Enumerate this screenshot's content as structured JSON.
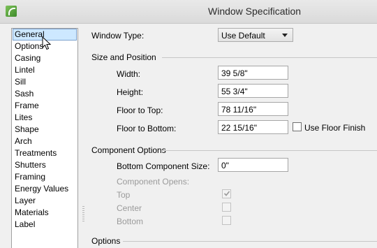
{
  "window": {
    "title": "Window Specification"
  },
  "nav": {
    "items": [
      {
        "label": "General",
        "selected": true
      },
      {
        "label": "Options"
      },
      {
        "label": "Casing"
      },
      {
        "label": "Lintel"
      },
      {
        "label": "Sill"
      },
      {
        "label": "Sash"
      },
      {
        "label": "Frame"
      },
      {
        "label": "Lites"
      },
      {
        "label": "Shape"
      },
      {
        "label": "Arch"
      },
      {
        "label": "Treatments"
      },
      {
        "label": "Shutters"
      },
      {
        "label": "Framing"
      },
      {
        "label": "Energy Values"
      },
      {
        "label": "Layer"
      },
      {
        "label": "Materials"
      },
      {
        "label": "Label"
      }
    ]
  },
  "window_type": {
    "label": "Window Type:",
    "value": "Use Default"
  },
  "size_position": {
    "heading": "Size and Position",
    "width_label": "Width:",
    "width_value": "39 5/8\"",
    "height_label": "Height:",
    "height_value": "55 3/4\"",
    "floor_top_label": "Floor to Top:",
    "floor_top_value": "78 11/16\"",
    "floor_bottom_label": "Floor to Bottom:",
    "floor_bottom_value": "22 15/16\"",
    "use_floor_finish_label": "Use Floor Finish",
    "use_floor_finish_checked": false
  },
  "component_options": {
    "heading": "Component Options",
    "bottom_size_label": "Bottom Component Size:",
    "bottom_size_value": "0\"",
    "opens_label": "Component Opens:",
    "top_label": "Top",
    "top_checked": true,
    "center_label": "Center",
    "center_checked": false,
    "bottom_label": "Bottom",
    "bottom_checked": false
  },
  "options": {
    "heading": "Options"
  }
}
